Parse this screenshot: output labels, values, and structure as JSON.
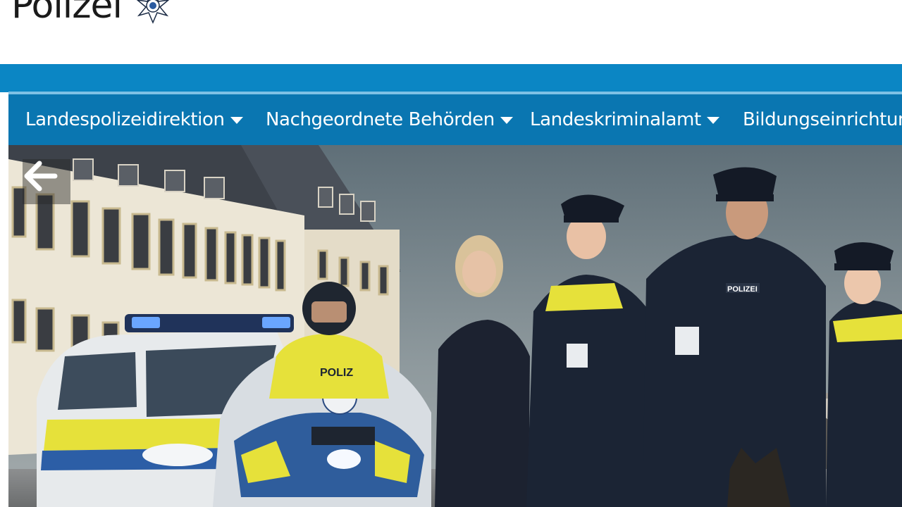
{
  "header": {
    "logo_text": "Polizei",
    "logo_icon": "police-star-icon"
  },
  "nav": {
    "items": [
      {
        "label": "Landespolizeidirektion",
        "has_dropdown": true
      },
      {
        "label": "Nachgeordnete Behörden",
        "has_dropdown": true
      },
      {
        "label": "Landeskriminalamt",
        "has_dropdown": true
      },
      {
        "label": "Bildungseinrichtung",
        "has_dropdown": false
      }
    ]
  },
  "hero": {
    "prev_icon": "arrow-left-icon",
    "badge_text": "POLIZEI",
    "bike_text": "POLIZ"
  },
  "colors": {
    "bluebar": "#0b86c4",
    "nav": "#0a76b1",
    "navline": "#7fc1e5",
    "police_yellow": "#e8e53a",
    "uniform": "#1b2434"
  }
}
